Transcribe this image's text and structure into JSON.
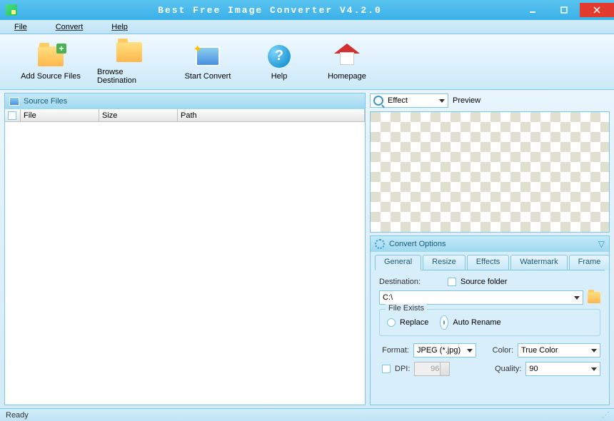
{
  "title": "Best Free Image Converter V4.2.0",
  "menu": {
    "file": "File",
    "convert": "Convert",
    "help": "Help"
  },
  "toolbar": {
    "add": "Add Source Files",
    "browse": "Browse Destination",
    "start": "Start Convert",
    "help": "Help",
    "home": "Homepage"
  },
  "panels": {
    "source": "Source Files",
    "preview": "Preview",
    "options": "Convert Options",
    "effect_default": "Effect"
  },
  "columns": {
    "file": "File",
    "size": "Size",
    "path": "Path"
  },
  "tabs": {
    "general": "General",
    "resize": "Resize",
    "effects": "Effects",
    "watermark": "Watermark",
    "frame": "Frame"
  },
  "general": {
    "destination_label": "Destination:",
    "source_folder": "Source folder",
    "destination_value": "C:\\",
    "file_exists": "File Exists",
    "replace": "Replace",
    "auto_rename": "Auto Rename",
    "format_label": "Format:",
    "format_value": "JPEG (*.jpg)",
    "color_label": "Color:",
    "color_value": "True Color",
    "dpi_label": "DPI:",
    "dpi_value": "96",
    "quality_label": "Quality:",
    "quality_value": "90"
  },
  "status": "Ready"
}
